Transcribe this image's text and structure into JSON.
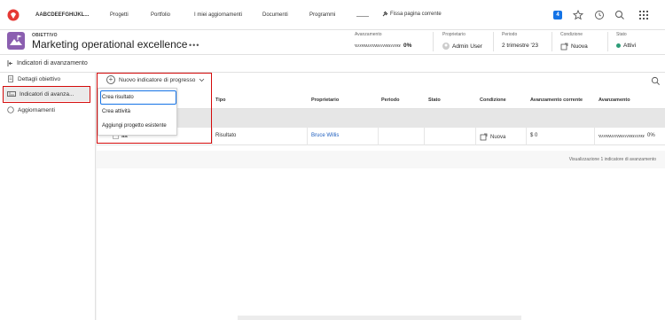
{
  "topnav": {
    "org": "AABCDEEFGHIJKL...",
    "items": [
      "Progetti",
      "Portfolio",
      "I miei aggiornamenti",
      "Documenti",
      "Programmi"
    ],
    "pin_label": "Fissa pagina corrente",
    "notif_count": "4"
  },
  "header": {
    "kicker": "OBIETTIVO",
    "title": "Marketing operational excellence",
    "dots": "•••",
    "avanzamento_label": "Avanzamento",
    "avanzamento_value": "0%",
    "proprietario_label": "Proprietario",
    "proprietario_value": "Admin User",
    "periodo_label": "Periodo",
    "periodo_value": "2 trimestre '23",
    "condizione_label": "Condizione",
    "condizione_value": "Nuova",
    "stato_label": "Stato",
    "stato_value": "Attivi",
    "stato_color": "#2d9d78"
  },
  "subbar": {
    "back_label": "Indicatori di avanzamento"
  },
  "sidebar": {
    "items": [
      {
        "label": "Dettagli obiettivo"
      },
      {
        "label": "Indicatori di avanza..."
      },
      {
        "label": "Aggiornamenti"
      }
    ]
  },
  "toolbar": {
    "new_label": "Nuovo indicatore di progresso"
  },
  "dropdown": {
    "items": [
      "Crea risultato",
      "Crea attività",
      "Aggiungi progetto esistente"
    ]
  },
  "table": {
    "headers": [
      "Tipo",
      "Proprietario",
      "Periodo",
      "Stato",
      "Condizione",
      "Avanzamento corrente",
      "Avanzamento"
    ],
    "row": {
      "name": "aa",
      "tipo": "Risultato",
      "proprietario": "Bruce Willis",
      "periodo": "",
      "stato": "",
      "condizione": "Nuova",
      "avanzamento_corrente": "$ 0",
      "avanzamento": "0%"
    },
    "footer": "Visualizzazione 1 indicatore di avanzamento"
  }
}
